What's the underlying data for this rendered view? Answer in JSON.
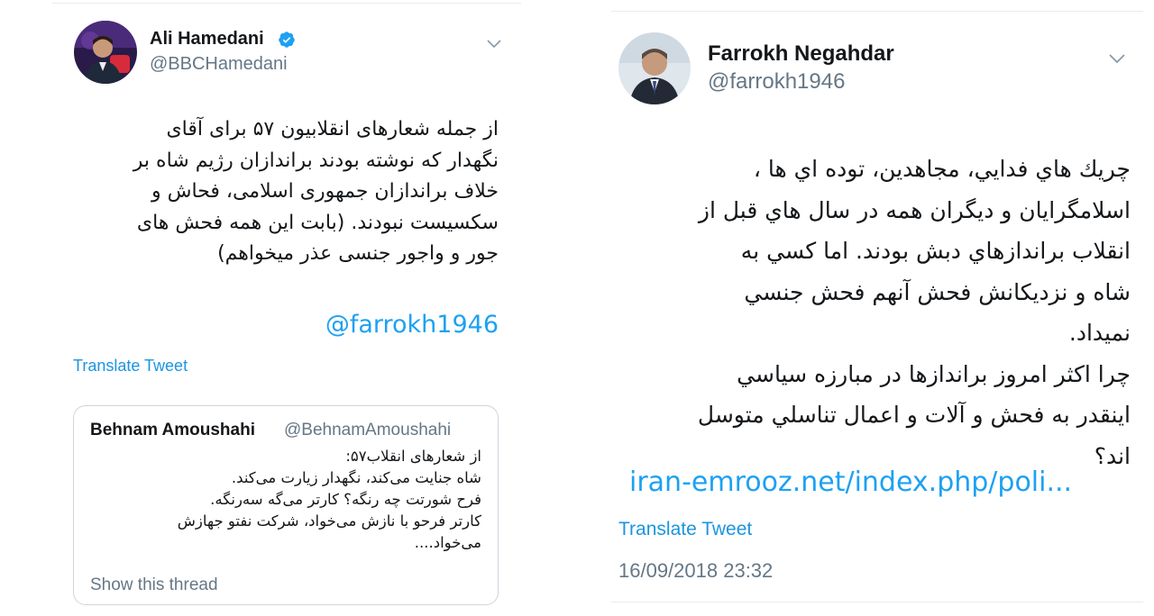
{
  "left_tweet": {
    "author_name": "Ali Hamedani",
    "author_handle": "@BBCHamedani",
    "verified": true,
    "text": "از جمله شعارهای انقلابیون ۵۷ برای آقای\nنگهدار که نوشته بودند  براندازان رژیم شاه بر\nخلاف براندازان جمهوری اسلامی، فحاش و\nسکسیست نبودند. (بابت این همه فحش های\nجور و واجور جنسی عذر میخواهم)",
    "mention": "@farrokh1946",
    "translate_label": "Translate Tweet",
    "quoted": {
      "author_name": "Behnam Amoushahi",
      "author_handle": "@BehnamAmoushahi",
      "text": "از شعارهای انقلاب۵۷:\nشاه جنایت می‌کند، نگهدار زیارت می‌کند.\nفرح شورتت چه رنگه؟ کارتر می‌گه سه‌رنگه.\nکارتر فرحو با نازش می‌خواد، شرکت نفتو جهازش\nمی‌خواد....",
      "show_thread_label": "Show this thread"
    }
  },
  "right_tweet": {
    "author_name": "Farrokh Negahdar",
    "author_handle": "@farrokh1946",
    "text": "چريك هاي فدايي، مجاهدين، توده اي ها ،\nاسلامگرايان و ديگران همه در سال هاي قبل از\nانقلاب براندازهاي دبش بودند. اما كسي به\nشاه و نزديكانش فحش آنهم فحش جنسي\nنميداد.\nچرا اكثر امروز براندازها در مبارزه سياسي\nاينقدر به فحش و آلات و اعمال تناسلي متوسل\nاند؟",
    "link_text": "iran-emrooz.net/index.php/poli...",
    "translate_label": "Translate Tweet",
    "timestamp": "16/09/2018 23:32"
  },
  "colors": {
    "link": "#1da1f2",
    "verified": "#1da1f2",
    "secondary_text": "#657786",
    "border": "#ccd6dd"
  },
  "icons": [
    "verified-badge-icon",
    "chevron-down-icon"
  ]
}
